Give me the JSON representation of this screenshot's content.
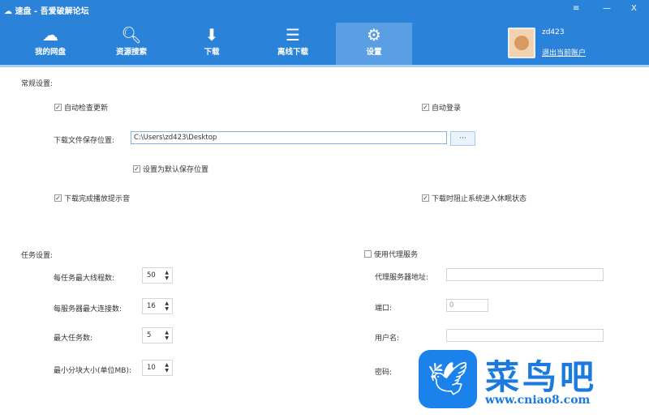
{
  "window": {
    "title": "速盘 - 吾爱破解论坛",
    "menu": "≡",
    "minimize": "—",
    "close": "X"
  },
  "tabs": [
    {
      "label": "我的网盘",
      "icon": "cloud-icon",
      "glyph": "☁"
    },
    {
      "label": "资源搜索",
      "icon": "search-icon",
      "glyph": "🔍︎"
    },
    {
      "label": "下载",
      "icon": "download-icon",
      "glyph": "⬇"
    },
    {
      "label": "离线下载",
      "icon": "list-icon",
      "glyph": "☰"
    },
    {
      "label": "设置",
      "icon": "gear-icon",
      "glyph": "⚙"
    }
  ],
  "user": {
    "name": "zd423",
    "logout": "退出当前账户"
  },
  "general": {
    "title": "常规设置:",
    "auto_update": "自动检查更新",
    "auto_login": "自动登录",
    "save_path_label": "下载文件保存位置:",
    "save_path": "C:\\Users\\zd423\\Desktop",
    "browse": "···",
    "set_default": "设置为默认保存位置",
    "play_sound": "下载完成播放提示音",
    "prevent_sleep": "下载时阻止系统进入休眠状态"
  },
  "task": {
    "title": "任务设置:",
    "items": [
      {
        "label": "每任务最大线程数:",
        "value": "50"
      },
      {
        "label": "每服务器最大连接数:",
        "value": "16"
      },
      {
        "label": "最大任务数:",
        "value": "5"
      },
      {
        "label": "最小分块大小(单位MB):",
        "value": "10"
      }
    ]
  },
  "proxy": {
    "enable": "使用代理服务",
    "address_label": "代理服务器地址:",
    "address": "",
    "port_label": "端口:",
    "port": "0",
    "user_label": "用户名:",
    "user": "",
    "password_label": "密码:"
  },
  "watermark": {
    "name": "菜鸟吧",
    "url": "www.cniao8.com"
  },
  "colors": {
    "header": "#2b82d9",
    "active_tab": "#5a9fe3"
  }
}
